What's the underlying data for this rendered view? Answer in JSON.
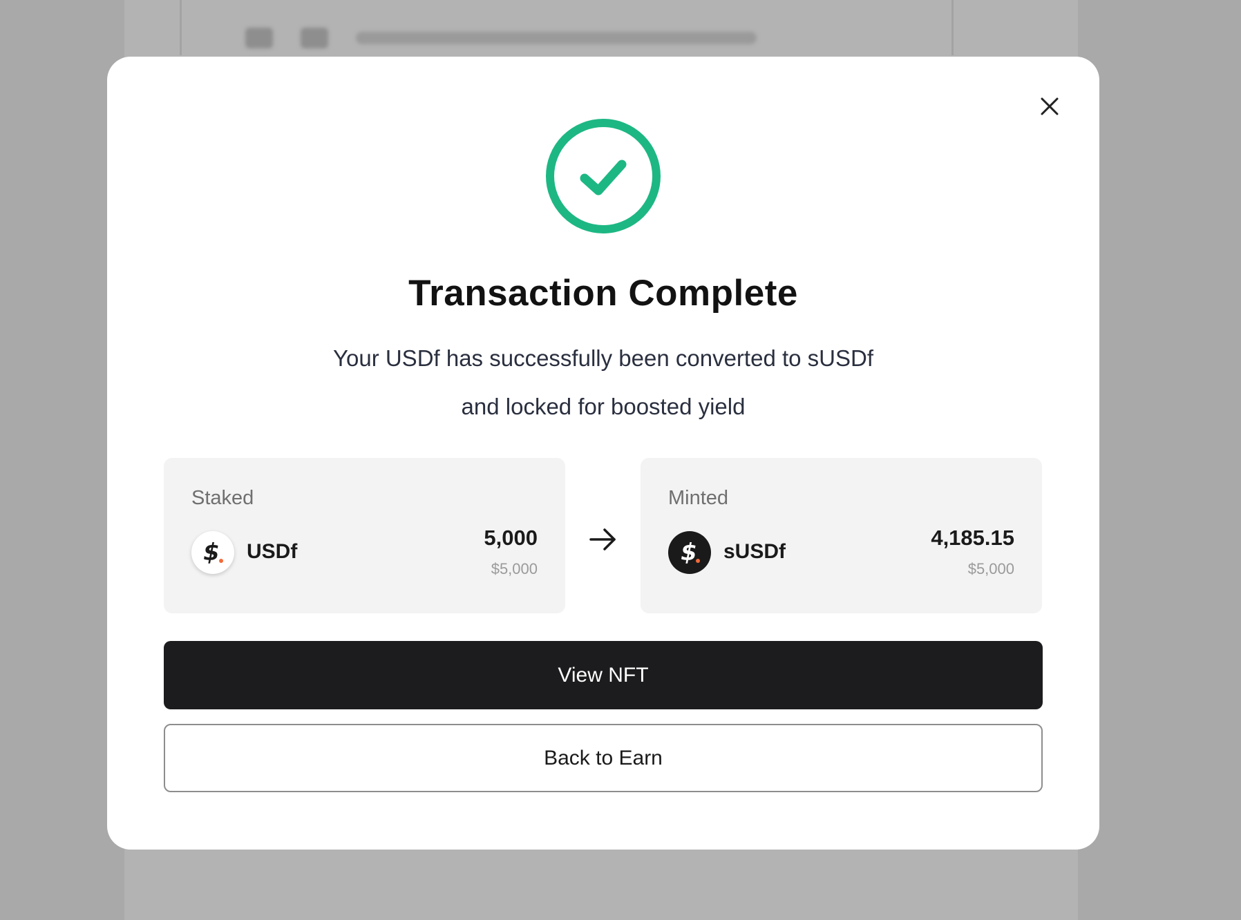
{
  "modal": {
    "title": "Transaction Complete",
    "subtitle_line1": "Your USDf has successfully been converted to sUSDf",
    "subtitle_line2": "and locked for boosted yield",
    "close_icon": "close-icon",
    "status_icon": "check-circle-icon"
  },
  "staked": {
    "label": "Staked",
    "token": "USDf",
    "amount": "5,000",
    "usd_value": "$5,000",
    "icon": "usdf-icon"
  },
  "minted": {
    "label": "Minted",
    "token": "sUSDf",
    "amount": "4,185.15",
    "usd_value": "$5,000",
    "icon": "susdf-icon"
  },
  "arrow_icon": "arrow-right-icon",
  "buttons": {
    "view_nft": "View NFT",
    "back_to_earn": "Back to Earn"
  },
  "colors": {
    "success": "#1db784",
    "primary_button": "#1c1c1e",
    "token_accent": "#f26b3a",
    "overlay": "#a9a9a9"
  }
}
